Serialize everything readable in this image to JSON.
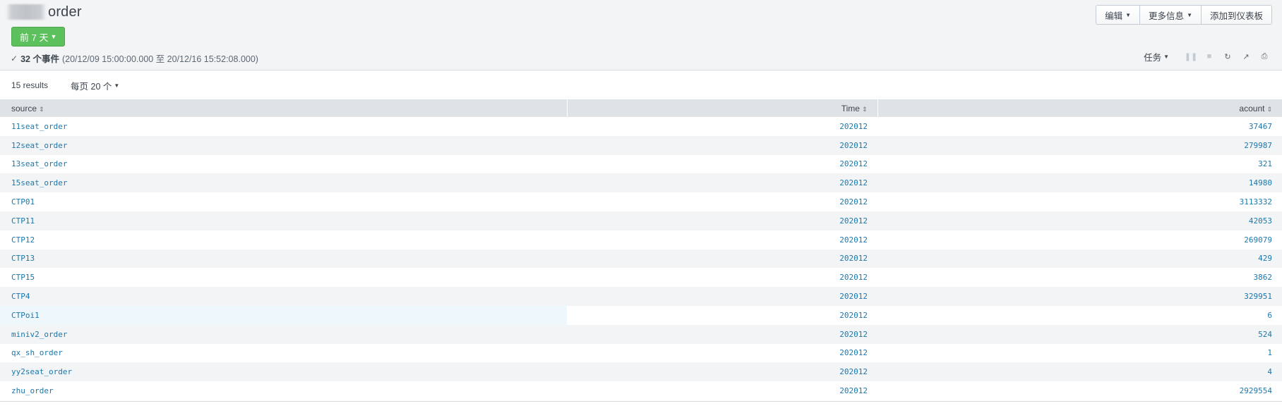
{
  "header": {
    "title": "order",
    "time_range_label": "前 7 天",
    "event_count": "32 个事件",
    "event_range": "(20/12/09 15:00:00.000 至 20/12/16 15:52:08.000)",
    "buttons": {
      "edit": "编辑",
      "more_info": "更多信息",
      "add_dashboard": "添加到仪表板"
    },
    "job_label": "任务"
  },
  "results": {
    "count_label": "15 results",
    "per_page_label": "每页 20 个"
  },
  "table": {
    "columns": [
      "source",
      "Time",
      "acount"
    ],
    "rows": [
      [
        "11seat_order",
        "202012",
        "37467"
      ],
      [
        "12seat_order",
        "202012",
        "279987"
      ],
      [
        "13seat_order",
        "202012",
        "321"
      ],
      [
        "15seat_order",
        "202012",
        "14980"
      ],
      [
        "CTP01",
        "202012",
        "3113332"
      ],
      [
        "CTP11",
        "202012",
        "42053"
      ],
      [
        "CTP12",
        "202012",
        "269079"
      ],
      [
        "CTP13",
        "202012",
        "429"
      ],
      [
        "CTP15",
        "202012",
        "3862"
      ],
      [
        "CTP4",
        "202012",
        "329951"
      ],
      [
        "CTPoi1",
        "202012",
        "6"
      ],
      [
        "miniv2_order",
        "202012",
        "524"
      ],
      [
        "qx_sh_order",
        "202012",
        "1"
      ],
      [
        "yy2seat_order",
        "202012",
        "4"
      ],
      [
        "zhu_order",
        "202012",
        "2929554"
      ]
    ]
  },
  "colors": {
    "accent_green": "#5cc05c",
    "link_blue": "#1a78ae",
    "header_bg": "#f2f4f5"
  }
}
